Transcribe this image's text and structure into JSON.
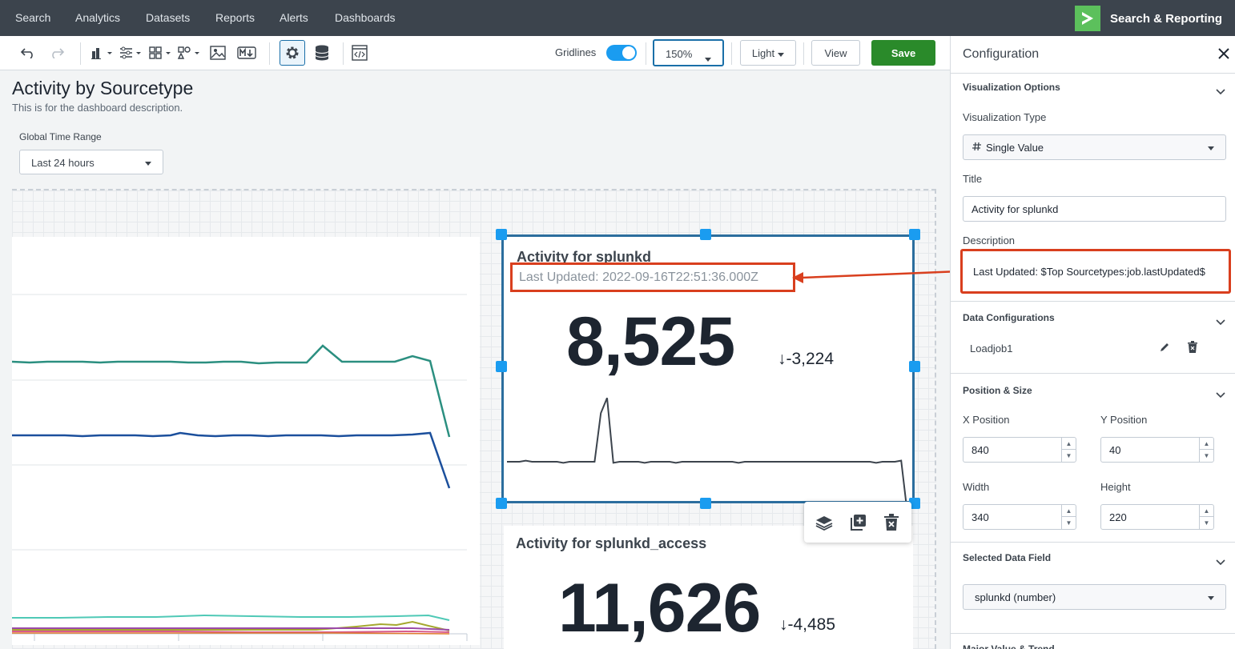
{
  "topnav": {
    "items": [
      "Search",
      "Analytics",
      "Datasets",
      "Reports",
      "Alerts",
      "Dashboards"
    ],
    "app_name": "Search & Reporting"
  },
  "toolbar": {
    "gridlines_label": "Gridlines",
    "gridlines_on": true,
    "zoom": "150%",
    "theme": "Light",
    "view_label": "View",
    "save_label": "Save"
  },
  "dashboard": {
    "title": "Activity by Sourcetype",
    "description": "This is for the dashboard description.",
    "time_range_label": "Global Time Range",
    "time_range_value": "Last 24 hours"
  },
  "panels": {
    "splunkd": {
      "title": "Activity for splunkd",
      "description": "Last Updated: 2022-09-16T22:51:36.000Z",
      "value": "8,525",
      "delta": "-3,224",
      "sparkline": [
        3,
        3,
        3,
        4,
        3,
        3,
        3,
        3,
        3,
        2,
        3,
        3,
        3,
        3,
        3,
        48,
        62,
        2,
        3,
        3,
        3,
        3,
        2,
        3,
        3,
        3,
        3,
        2,
        3,
        3,
        3,
        3,
        3,
        3,
        3,
        3,
        3,
        2,
        3,
        3,
        3,
        3,
        3,
        3,
        3,
        3,
        3,
        3,
        3,
        3,
        3,
        3,
        3,
        3,
        3,
        3,
        3,
        3,
        3,
        2,
        3,
        3,
        3,
        4,
        -45
      ]
    },
    "splunkd_access": {
      "title": "Activity for splunkd_access",
      "value": "11,626",
      "delta": "-4,485"
    }
  },
  "colors": {
    "nav_bg": "#3c444d",
    "accent_blue": "#1a9cf0",
    "save_green": "#2a8a2a",
    "highlight_red": "#d93f1e",
    "series_teal": "#2b8f80",
    "series_blue": "#1b4f9c"
  },
  "config": {
    "title": "Configuration",
    "sections": {
      "viz_options": "Visualization Options",
      "data_config": "Data Configurations",
      "position_size": "Position & Size",
      "selected_field": "Selected Data Field",
      "major_value": "Major Value & Trend"
    },
    "viz_type_label": "Visualization Type",
    "viz_type_value": "Single Value",
    "title_label": "Title",
    "title_value": "Activity for splunkd",
    "description_label": "Description",
    "description_value": "Last Updated: $Top Sourcetypes:job.lastUpdated$",
    "data_source": "Loadjob1",
    "x_label": "X Position",
    "x_value": "840",
    "y_label": "Y Position",
    "y_value": "40",
    "width_label": "Width",
    "width_value": "340",
    "height_label": "Height",
    "height_value": "220",
    "selected_field_value": "splunkd (number)"
  }
}
